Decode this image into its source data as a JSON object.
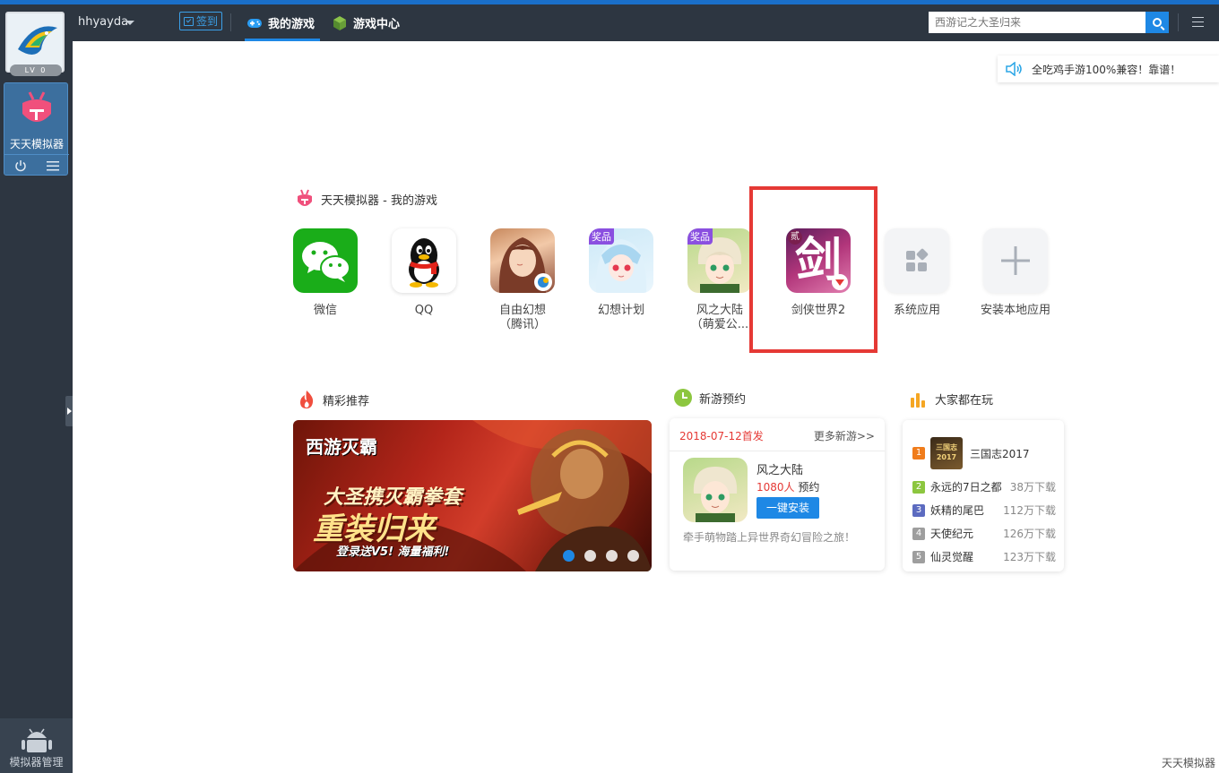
{
  "topbar": {
    "username": "hhyayda",
    "sign_label": "签到",
    "tabs": [
      {
        "label": "我的游戏",
        "active": true
      },
      {
        "label": "游戏中心",
        "active": false
      }
    ],
    "search": {
      "placeholder": "西游记之大圣归来"
    },
    "accent_color": "#1e88e5"
  },
  "sidebar": {
    "level": "LV 0",
    "app_label": "天天模拟器",
    "manager_label": "模拟器管理"
  },
  "notice": {
    "text": "全吃鸡手游100%兼容！靠谱！"
  },
  "my_games": {
    "title": "天天模拟器 - 我的游戏",
    "apps": [
      {
        "label": "微信",
        "icon": "wechat-icon"
      },
      {
        "label": "QQ",
        "icon": "qq-penguin-icon"
      },
      {
        "label": "自由幻想\n（腾讯）",
        "icon": "game-icon"
      },
      {
        "label": "幻想计划",
        "icon": "game-icon",
        "tag": "奖品"
      },
      {
        "label": "风之大陆\n（萌爱公...",
        "icon": "game-icon",
        "tag": "奖品"
      },
      {
        "label": "剑侠世界2",
        "icon": "game-icon",
        "icon_char": "剑",
        "icon_badge": "贰"
      },
      {
        "label": "系统应用",
        "icon": "grid-icon"
      },
      {
        "label": "安装本地应用",
        "icon": "plus-icon"
      }
    ]
  },
  "featured": {
    "title": "精彩推荐",
    "banner": {
      "logo": "西游灭霸",
      "headline_1": "大圣携灭霸拳套",
      "headline_2": "重装归来",
      "sub": "登录送V5!  海量福利!"
    },
    "dots": 4,
    "active_dot": 0
  },
  "new_games": {
    "title": "新游预约",
    "date": "2018-07-12首发",
    "more": "更多新游>>",
    "game_name": "风之大陆",
    "count": "1080人",
    "count_suffix": "预约",
    "install_label": "一键安装",
    "desc": "牵手萌物踏上异世界奇幻冒险之旅！"
  },
  "popular": {
    "title": "大家都在玩",
    "top": {
      "rank": "1",
      "name": "三国志2017",
      "thumb_text": "三国志\n2017"
    },
    "items": [
      {
        "rank": "2",
        "name": "永远的7日之都",
        "downloads": "38万下载"
      },
      {
        "rank": "3",
        "name": "妖精的尾巴",
        "downloads": "112万下载"
      },
      {
        "rank": "4",
        "name": "天使纪元",
        "downloads": "126万下载"
      },
      {
        "rank": "5",
        "name": "仙灵觉醒",
        "downloads": "123万下载"
      }
    ]
  },
  "footer": {
    "watermark": "天天模拟器"
  }
}
